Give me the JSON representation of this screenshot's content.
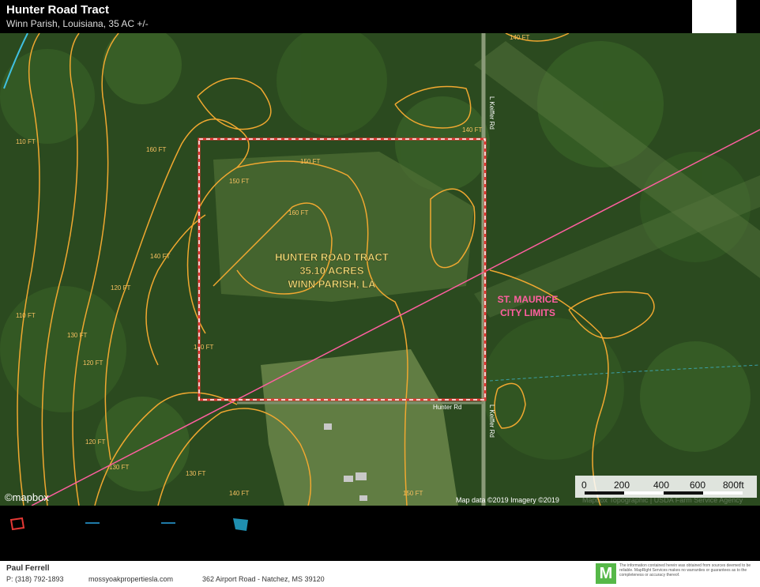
{
  "header": {
    "title": "Hunter Road Tract",
    "subtitle": "Winn Parish, Louisiana, 35 AC +/-"
  },
  "map": {
    "tract_label": [
      "HUNTER ROAD TRACT",
      "35.10 ACRES",
      "WINN PARISH, LA"
    ],
    "city_label": [
      "ST. MAURICE",
      "CITY LIMITS"
    ],
    "road_labels": [
      "L Keiffer Rd",
      "L Keiffer Rd",
      "Hunter Rd"
    ],
    "contour_labels": [
      "140 FT",
      "150 FT",
      "160 FT",
      "130 FT",
      "120 FT",
      "110 FT"
    ],
    "scale": {
      "labels": [
        "0",
        "200",
        "400",
        "600",
        "800ft"
      ]
    },
    "attribution": "Map data ©2019  Imagery ©2019",
    "attribution_faded": "Mapbox Topographic | USDA Farm Service Agency",
    "watermark": "©mapbox",
    "colors": {
      "boundary": "#e53935",
      "contour": "#f0a830",
      "city_line": "#ff5fa0",
      "water": "#40c0e0"
    }
  },
  "legend": {
    "items": [
      "boundary-swatch",
      "contour-line",
      "road-line",
      "water-swatch"
    ]
  },
  "footer": {
    "agent_name": "Paul Ferrell",
    "phone": "P: (318) 792-1893",
    "website": "mossyoakpropertiesla.com",
    "address": "362 Airport Road - Natchez, MS 39120",
    "logo_letter": "M",
    "disclaimer": "The information contained herein was obtained from sources deemed to be reliable. MapRight Services makes no warranties or guarantees as to the completeness or accuracy thereof."
  }
}
